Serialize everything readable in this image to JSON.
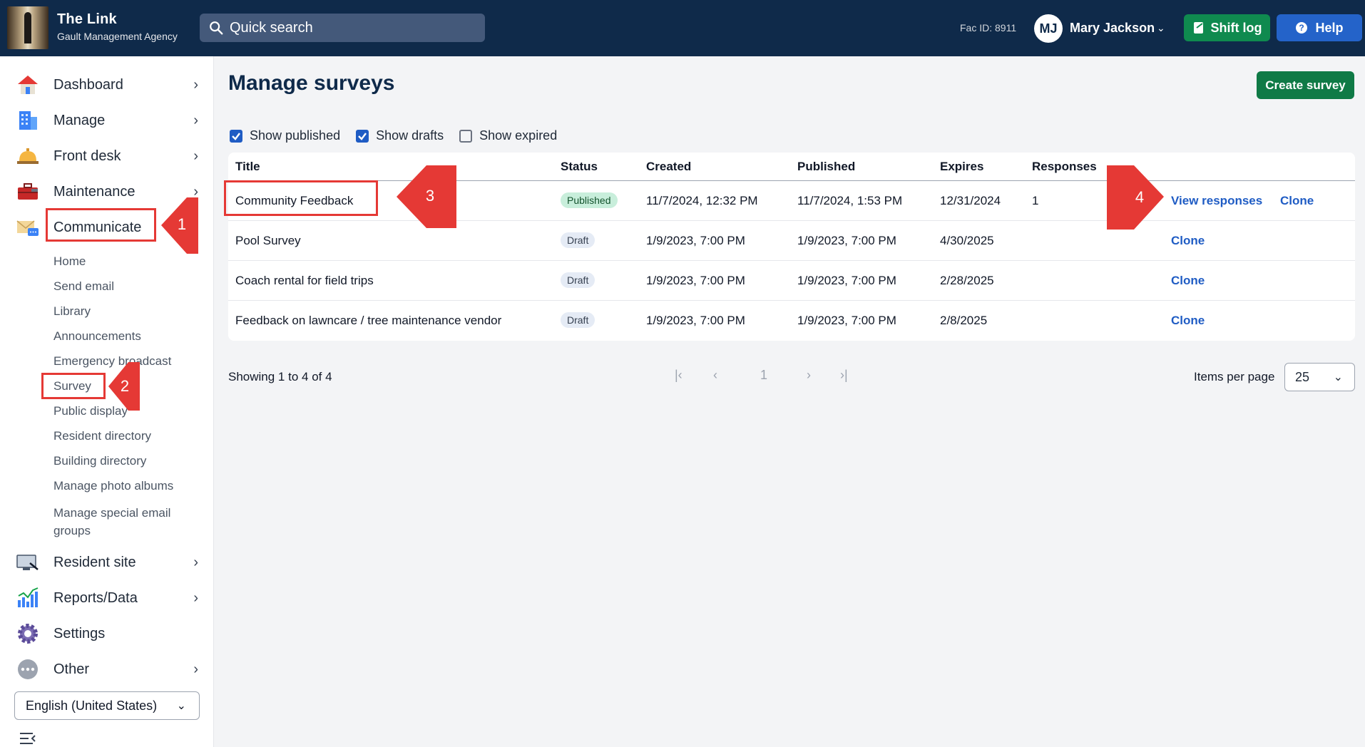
{
  "header": {
    "app_title": "The Link",
    "org_name": "Gault Management Agency",
    "search_placeholder": "Quick search",
    "fac_id": "Fac ID: 8911",
    "user_initials": "MJ",
    "user_name": "Mary Jackson",
    "shift_log_label": "Shift log",
    "help_label": "Help"
  },
  "sidebar": {
    "nav": [
      {
        "label": "Dashboard",
        "icon": "house-icon"
      },
      {
        "label": "Manage",
        "icon": "building-icon"
      },
      {
        "label": "Front desk",
        "icon": "bell-icon"
      },
      {
        "label": "Maintenance",
        "icon": "toolbox-icon"
      },
      {
        "label": "Communicate",
        "icon": "mail-chat-icon"
      }
    ],
    "communicate_sub": [
      "Home",
      "Send email",
      "Library",
      "Announcements",
      "Emergency broadcast",
      "Survey",
      "Public display",
      "Resident directory",
      "Building directory",
      "Manage photo albums",
      "Manage special email groups"
    ],
    "nav_bottom": [
      {
        "label": "Resident site",
        "icon": "monitor-icon"
      },
      {
        "label": "Reports/Data",
        "icon": "chart-icon"
      },
      {
        "label": "Settings",
        "icon": "gear-icon"
      },
      {
        "label": "Other",
        "icon": "more-icon"
      }
    ],
    "language": "English (United States)"
  },
  "main": {
    "title": "Manage surveys",
    "create_label": "Create survey",
    "filters": [
      {
        "label": "Show published",
        "checked": true
      },
      {
        "label": "Show drafts",
        "checked": true
      },
      {
        "label": "Show expired",
        "checked": false
      }
    ],
    "columns": [
      "Title",
      "Status",
      "Created",
      "Published",
      "Expires",
      "Responses"
    ],
    "rows": [
      {
        "title": "Community Feedback",
        "status": "Published",
        "created": "11/7/2024, 12:32 PM",
        "published": "11/7/2024, 1:53 PM",
        "expires": "12/31/2024",
        "responses": "1",
        "view": "View responses",
        "clone": "Clone"
      },
      {
        "title": "Pool Survey",
        "status": "Draft",
        "created": "1/9/2023, 7:00 PM",
        "published": "1/9/2023, 7:00 PM",
        "expires": "4/30/2025",
        "responses": "",
        "view": "",
        "clone": "Clone"
      },
      {
        "title": "Coach rental for field trips",
        "status": "Draft",
        "created": "1/9/2023, 7:00 PM",
        "published": "1/9/2023, 7:00 PM",
        "expires": "2/28/2025",
        "responses": "",
        "view": "",
        "clone": "Clone"
      },
      {
        "title": "Feedback on lawncare / tree maintenance vendor",
        "status": "Draft",
        "created": "1/9/2023, 7:00 PM",
        "published": "1/9/2023, 7:00 PM",
        "expires": "2/8/2025",
        "responses": "",
        "view": "",
        "clone": "Clone"
      }
    ],
    "showing": "Showing 1 to 4 of 4",
    "current_page": "1",
    "items_per_page_label": "Items per page",
    "items_per_page": "25"
  },
  "annotations": {
    "step1": "1",
    "step2": "2",
    "step3": "3",
    "step4": "4",
    "color": "#e53935"
  }
}
